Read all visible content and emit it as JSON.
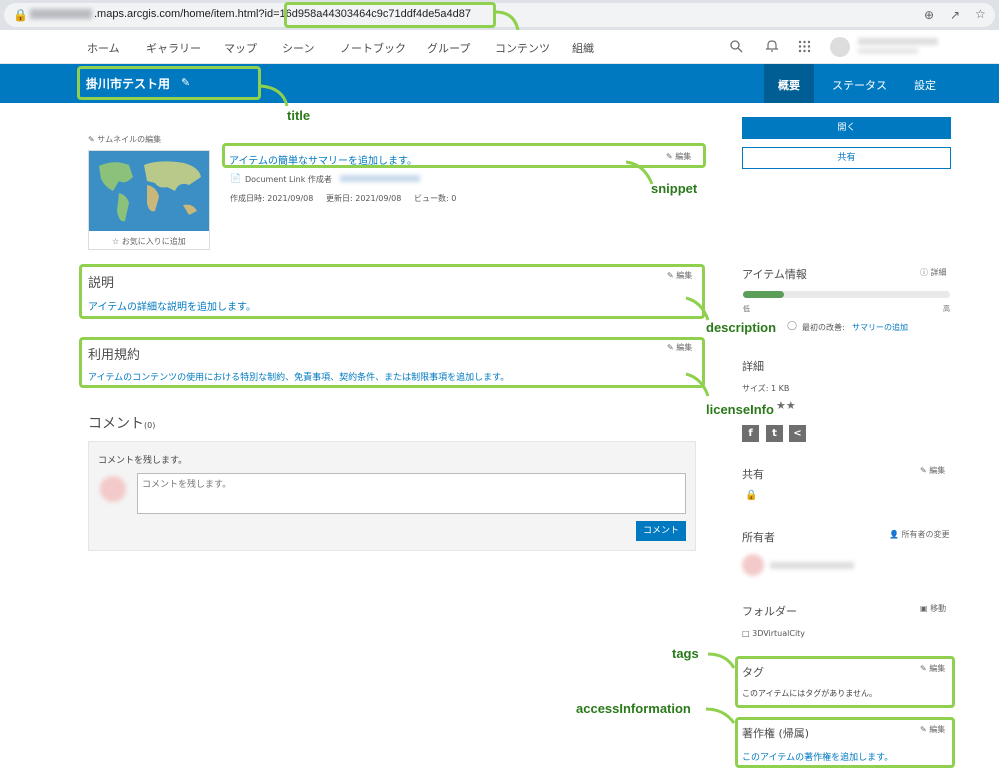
{
  "browser": {
    "url_domain": ".maps.arcgis.com/home/item.html?id=",
    "url_id": "16d958a44303464c9c71ddf4de5a4d87"
  },
  "nav": {
    "items": [
      "ホーム",
      "ギャラリー",
      "マップ",
      "シーン",
      "ノートブック",
      "グループ",
      "コンテンツ",
      "組織"
    ]
  },
  "header": {
    "title": "掛川市テスト用",
    "tabs": [
      "概要",
      "ステータス",
      "設定"
    ]
  },
  "overview": {
    "thumb_edit": "サムネイルの編集",
    "favorite": "お気に入りに追加",
    "snippet": "アイテムの簡単なサマリーを追加します。",
    "edit": "編集",
    "doc_type": "Document Link 作成者",
    "created": "作成日時: 2021/09/08",
    "modified": "更新日: 2021/09/08",
    "views": "ビュー数: 0"
  },
  "description": {
    "title": "説明",
    "text": "アイテムの詳細な説明を追加します。"
  },
  "license": {
    "title": "利用規約",
    "text": "アイテムのコンテンツの使用における特別な制約、免責事項、契約条件、または制限事項を追加します。"
  },
  "comments": {
    "title": "コメント",
    "count": "(0)",
    "prompt": "コメントを残します。",
    "placeholder": "コメントを残します。",
    "button": "コメント"
  },
  "sidebar": {
    "open": "開く",
    "share": "共有",
    "item_info": "アイテム情報",
    "detail_link": "詳細",
    "progress": 0.2,
    "progress_left": "低",
    "progress_right": "高",
    "first_improve": "最初の改善:",
    "add_summary": "サマリーの追加",
    "details_title": "詳細",
    "size": "サイズ: 1 KB",
    "sharing_title": "共有",
    "owner_title": "所有者",
    "change_owner": "所有者の変更",
    "folder_title": "フォルダー",
    "move": "移動",
    "folder_name": "3DVirtualCity",
    "tags_title": "タグ",
    "tags_text": "このアイテムにはタグがありません。",
    "credits_title": "著作権 (帰属)",
    "credits_text": "このアイテムの著作権を追加します。",
    "edit": "編集"
  },
  "annotations": {
    "id": "id",
    "title": "title",
    "snippet": "snippet",
    "description": "description",
    "licenseInfo": "licenseInfo",
    "tags": "tags",
    "accessInformation": "accessInformation"
  },
  "colors": {
    "brand": "#0079c1",
    "callout": "#8fd14f",
    "callout_text": "#2a7a1a"
  }
}
